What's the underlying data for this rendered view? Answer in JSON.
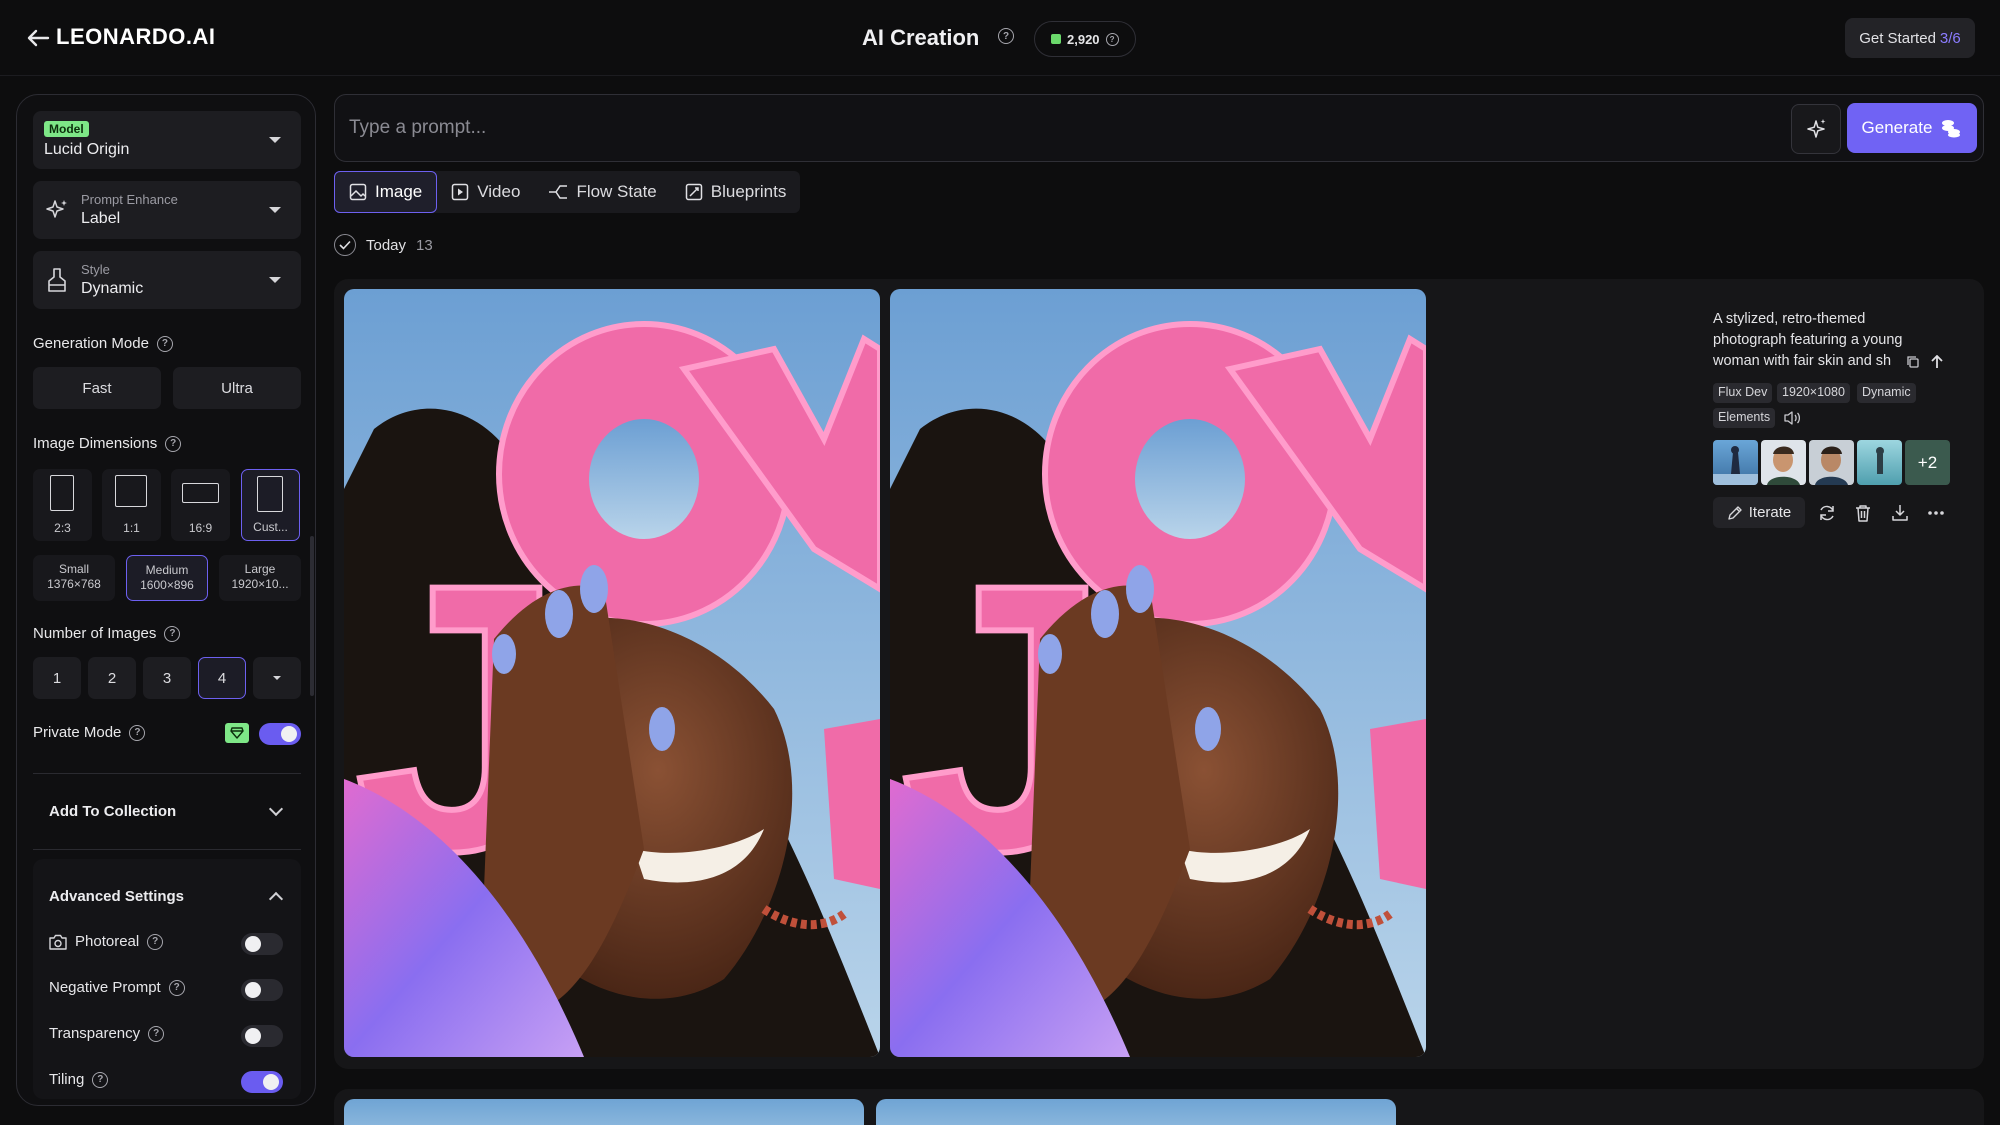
{
  "topbar": {
    "logo": "LEONARDO.AI",
    "title": "AI Creation",
    "credits": "2,920",
    "get_started_label": "Get Started",
    "get_started_progress": "3/6"
  },
  "sidebar": {
    "model": {
      "badge": "Model",
      "value": "Lucid Origin"
    },
    "prompt_enhance": {
      "label": "Prompt Enhance",
      "value": "Label"
    },
    "style": {
      "label": "Style",
      "value": "Dynamic"
    },
    "generation_mode": {
      "label": "Generation Mode",
      "options": [
        "Fast",
        "Ultra"
      ]
    },
    "image_dimensions": {
      "label": "Image Dimensions",
      "ratios": [
        "2:3",
        "1:1",
        "16:9",
        "Cust..."
      ],
      "selected_ratio": "Cust...",
      "sizes": [
        {
          "name": "Small",
          "dims": "1376×768"
        },
        {
          "name": "Medium",
          "dims": "1600×896"
        },
        {
          "name": "Large",
          "dims": "1920×10..."
        }
      ],
      "selected_size": "Medium"
    },
    "number_of_images": {
      "label": "Number of Images",
      "options": [
        "1",
        "2",
        "3",
        "4"
      ],
      "selected": "4"
    },
    "private_mode": {
      "label": "Private Mode",
      "on": true
    },
    "add_to_collection": "Add To Collection",
    "advanced_settings": {
      "label": "Advanced Settings",
      "rows": [
        {
          "label": "Photoreal",
          "on": false
        },
        {
          "label": "Negative Prompt",
          "on": false
        },
        {
          "label": "Transparency",
          "on": false
        },
        {
          "label": "Tiling",
          "on": true
        }
      ]
    }
  },
  "prompt": {
    "placeholder": "Type a prompt...",
    "generate_label": "Generate"
  },
  "tabs": [
    "Image",
    "Video",
    "Flow State",
    "Blueprints"
  ],
  "selected_tab": "Image",
  "feed": {
    "group_label": "Today",
    "group_count": "13",
    "generation": {
      "description": "A stylized, retro-themed photograph featuring a young woman with fair skin and sh",
      "tags": [
        "Flux Dev",
        "1920×1080",
        "Dynamic",
        "Elements"
      ],
      "extra_refs": "+2",
      "iterate_label": "Iterate",
      "image_text": "JOY"
    }
  },
  "colors": {
    "accent": "#7063f4",
    "background": "#0d0d0e",
    "card": "#161618",
    "badge_green": "#7ee787",
    "pink": "#f06ba8"
  }
}
